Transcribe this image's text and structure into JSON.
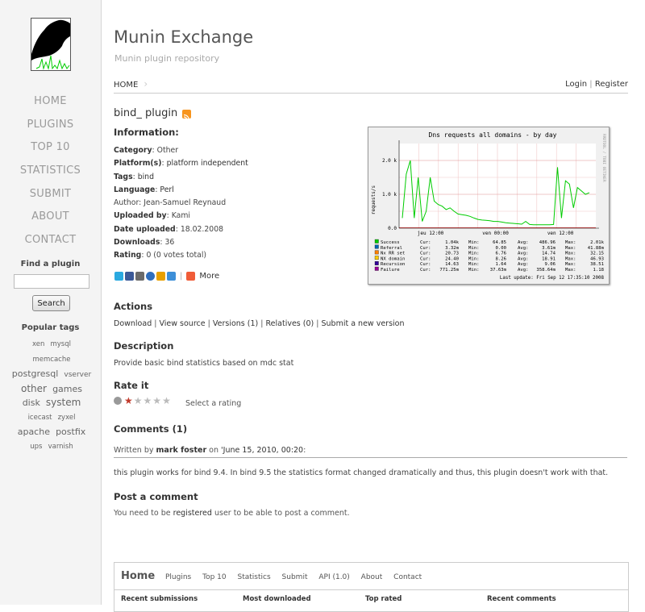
{
  "sidebar": {
    "nav": [
      "HOME",
      "PLUGINS",
      "TOP 10",
      "STATISTICS",
      "SUBMIT",
      "ABOUT",
      "CONTACT"
    ],
    "find_title": "Find a plugin",
    "search_button": "Search",
    "tags_title": "Popular tags",
    "tags": [
      "xen",
      "mysql",
      "memcache",
      "postgresql",
      "vserver",
      "other",
      "games",
      "disk",
      "system",
      "icecast",
      "zyxel",
      "apache",
      "postfix",
      "ups",
      "varnish"
    ]
  },
  "header": {
    "site_title": "Munin Exchange",
    "subtitle": "Munin plugin repository",
    "breadcrumb": "HOME",
    "login": "Login",
    "register": "Register",
    "auth_sep": "|"
  },
  "plugin": {
    "title": "bind_ plugin",
    "info_heading": "Information:",
    "fields": {
      "category_label": "Category",
      "category_value": "Other",
      "platforms_label": "Platform(s)",
      "platforms_value": "platform independent",
      "tags_label": "Tags",
      "tags_value": "bind",
      "language_label": "Language",
      "language_value": "Perl",
      "author_label": "Author",
      "author_value": "Jean-Samuel Reynaud",
      "uploaded_by_label": "Uploaded by",
      "uploaded_by_value": "Kami",
      "date_label": "Date uploaded",
      "date_value": "18.02.2008",
      "downloads_label": "Downloads",
      "downloads_value": "36",
      "rating_label": "Rating",
      "rating_value": "0 (0 votes total)"
    },
    "share_more": "More"
  },
  "graph": {
    "title": "Dns requests  all domains - by day",
    "ylabel": "requests/s",
    "side_label": "RRDTOOL / TOBI OETIKER",
    "y_ticks": [
      "2.0 k",
      "1.0 k",
      "0.0"
    ],
    "x_ticks": [
      "jeu 12:00",
      "ven 00:00",
      "ven 12:00"
    ],
    "legend": [
      {
        "name": "Success",
        "color": "#00cc00",
        "cur": "1.04k",
        "min": "64.85",
        "avg": "486.96",
        "max": "2.01k"
      },
      {
        "name": "Referral",
        "color": "#0066b3",
        "cur": "3.32m",
        "min": "0.00",
        "avg": "3.61m",
        "max": "41.88m"
      },
      {
        "name": "Nx RR set",
        "color": "#ff8000",
        "cur": "20.73",
        "min": "6.76",
        "avg": "14.74",
        "max": "32.15"
      },
      {
        "name": "NX domain",
        "color": "#ffcc00",
        "cur": "24.40",
        "min": "8.26",
        "avg": "18.91",
        "max": "46.93"
      },
      {
        "name": "Recursion",
        "color": "#330099",
        "cur": "14.63",
        "min": "1.64",
        "avg": "9.06",
        "max": "38.51"
      },
      {
        "name": "Failure",
        "color": "#990099",
        "cur": "771.25m",
        "min": "37.63m",
        "avg": "358.64m",
        "max": "1.18"
      }
    ],
    "cur_label": "Cur:",
    "min_label": "Min:",
    "avg_label": "Avg:",
    "max_label": "Max:",
    "last_update": "Last update:  Fri Sep 12 17:35:10 2008",
    "success_series": [
      300,
      1600,
      2000,
      300,
      1500,
      200,
      500,
      1500,
      800,
      700,
      650,
      550,
      600,
      500,
      420,
      400,
      380,
      350,
      300,
      260,
      240,
      230,
      220,
      200,
      200,
      180,
      160,
      150,
      140,
      130,
      120,
      200,
      110,
      100,
      100,
      100,
      100,
      100,
      110,
      1800,
      300,
      1400,
      1300,
      600,
      1200,
      1100,
      1000,
      1050
    ]
  },
  "actions": {
    "heading": "Actions",
    "links": [
      "Download",
      "View source",
      "Versions (1)",
      "Relatives (0)",
      "Submit a new version"
    ]
  },
  "description": {
    "heading": "Description",
    "text": "Provide basic bind statistics based on mdc stat"
  },
  "rate": {
    "heading": "Rate it",
    "label": "Select a rating",
    "rating": 1,
    "max": 5
  },
  "comments": {
    "heading": "Comments (1)",
    "written_by": "Written by",
    "author": "mark foster",
    "on": "on",
    "date": "June 15, 2010, 00:20",
    "text": "this plugin works for bind 9.4. In bind 9.5 the statistics format changed dramatically and thus, this plugin doesn't work with that."
  },
  "post": {
    "heading": "Post a comment",
    "text_before": "You need to be",
    "link": "registered",
    "text_after": "user to be able to post a comment."
  },
  "footer": {
    "home": "Home",
    "nav": [
      "Plugins",
      "Top 10",
      "Statistics",
      "Submit",
      "API (1.0)",
      "About",
      "Contact"
    ],
    "columns": [
      "Recent submissions",
      "Most downloaded",
      "Top rated",
      "Recent comments"
    ]
  }
}
